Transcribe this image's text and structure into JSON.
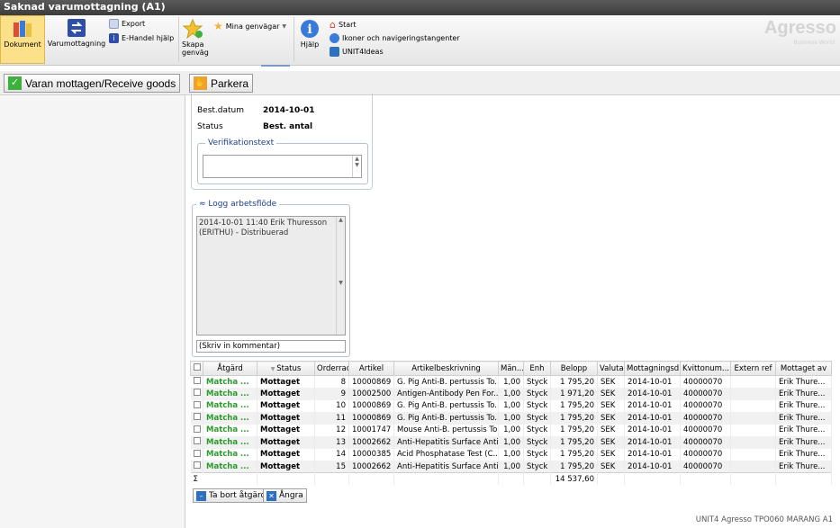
{
  "window": {
    "title": "Saknad varumottagning (A1)"
  },
  "ribbon": {
    "dokument": "Dokument",
    "varumottagning": "Varumottagning",
    "export": "Export",
    "ehandel_help": "E-Handel hjälp",
    "skapa_genvag": "Skapa genväg",
    "mina_genvagar": "Mina genvägar",
    "hjalp": "Hjälp",
    "start": "Start",
    "ikoner": "Ikoner och navigeringstangenter",
    "unit4ideas": "UNIT4Ideas",
    "brand": "Agresso",
    "brand_sub": "Business World"
  },
  "actions": {
    "receive": "Varan mottagen/Receive goods",
    "park": "Parkera"
  },
  "info": {
    "best_datum_label": "Best.datum",
    "best_datum_value": "2014-10-01",
    "status_label": "Status",
    "status_value": "Best. antal",
    "verif_legend": "Verifikationstext"
  },
  "log": {
    "legend": "Logg arbetsflöde",
    "entry": "2014-10-01 11:40 Erik Thuresson (ERITHU) - Distribuerad",
    "comment_placeholder": "(Skriv in kommentar)"
  },
  "grid": {
    "headers": [
      "Åtgärd",
      "Status",
      "Orderrad",
      "Artikel",
      "Artikelbeskrivning",
      "Män...",
      "Enh",
      "Belopp",
      "Valuta",
      "Mottagningsd...",
      "Kvittonum...",
      "Extern ref",
      "Mottaget av"
    ],
    "rows": [
      [
        "Matcha ...",
        "Mottaget",
        "8",
        "10000869",
        "G. Pig Anti-B. pertussis To...",
        "1,00",
        "Styck",
        "1 795,20",
        "SEK",
        "2014-10-01",
        "40000070",
        "",
        "Erik Thure..."
      ],
      [
        "Matcha ...",
        "Mottaget",
        "9",
        "10002500",
        "Antigen-Antibody Pen For...",
        "1,00",
        "Styck",
        "1 971,20",
        "SEK",
        "2014-10-01",
        "40000070",
        "",
        "Erik Thure..."
      ],
      [
        "Matcha ...",
        "Mottaget",
        "10",
        "10000869",
        "G. Pig Anti-B. pertussis To...",
        "1,00",
        "Styck",
        "1 795,20",
        "SEK",
        "2014-10-01",
        "40000070",
        "",
        "Erik Thure..."
      ],
      [
        "Matcha ...",
        "Mottaget",
        "11",
        "10000869",
        "G. Pig Anti-B. pertussis To...",
        "1,00",
        "Styck",
        "1 795,20",
        "SEK",
        "2014-10-01",
        "40000070",
        "",
        "Erik Thure..."
      ],
      [
        "Matcha ...",
        "Mottaget",
        "12",
        "10001747",
        "Mouse Anti-B. pertussis To...",
        "1,00",
        "Styck",
        "1 795,20",
        "SEK",
        "2014-10-01",
        "40000070",
        "",
        "Erik Thure..."
      ],
      [
        "Matcha ...",
        "Mottaget",
        "13",
        "10002662",
        "Anti-Hepatitis Surface Anti...",
        "1,00",
        "Styck",
        "1 795,20",
        "SEK",
        "2014-10-01",
        "40000070",
        "",
        "Erik Thure..."
      ],
      [
        "Matcha ...",
        "Mottaget",
        "14",
        "10000385",
        "Acid Phosphatase Test (C...",
        "1,00",
        "Styck",
        "1 795,20",
        "SEK",
        "2014-10-01",
        "40000070",
        "",
        "Erik Thure..."
      ],
      [
        "Matcha ...",
        "Mottaget",
        "15",
        "10002662",
        "Anti-Hepatitis Surface Anti...",
        "1,00",
        "Styck",
        "1 795,20",
        "SEK",
        "2014-10-01",
        "40000070",
        "",
        "Erik Thure..."
      ]
    ],
    "sum_symbol": "Σ",
    "sum_value": "14 537,60"
  },
  "grid_buttons": {
    "remove": "Ta bort åtgärd",
    "undo": "Ångra"
  },
  "status": "UNIT4 Agresso  TPO060  MARANG  A1"
}
